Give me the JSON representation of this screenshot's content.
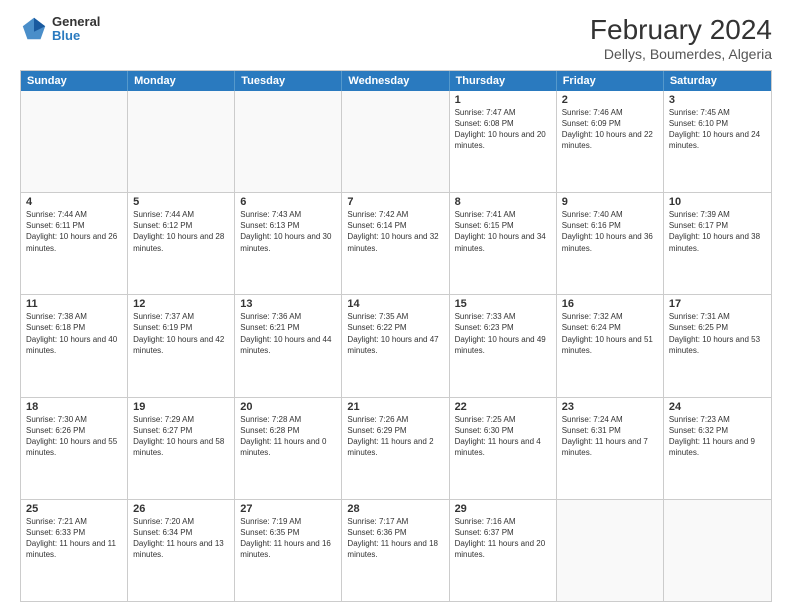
{
  "logo": {
    "general": "General",
    "blue": "Blue"
  },
  "title": "February 2024",
  "subtitle": "Dellys, Boumerdes, Algeria",
  "days": [
    "Sunday",
    "Monday",
    "Tuesday",
    "Wednesday",
    "Thursday",
    "Friday",
    "Saturday"
  ],
  "weeks": [
    [
      {
        "day": "",
        "text": ""
      },
      {
        "day": "",
        "text": ""
      },
      {
        "day": "",
        "text": ""
      },
      {
        "day": "",
        "text": ""
      },
      {
        "day": "1",
        "text": "Sunrise: 7:47 AM\nSunset: 6:08 PM\nDaylight: 10 hours and 20 minutes."
      },
      {
        "day": "2",
        "text": "Sunrise: 7:46 AM\nSunset: 6:09 PM\nDaylight: 10 hours and 22 minutes."
      },
      {
        "day": "3",
        "text": "Sunrise: 7:45 AM\nSunset: 6:10 PM\nDaylight: 10 hours and 24 minutes."
      }
    ],
    [
      {
        "day": "4",
        "text": "Sunrise: 7:44 AM\nSunset: 6:11 PM\nDaylight: 10 hours and 26 minutes."
      },
      {
        "day": "5",
        "text": "Sunrise: 7:44 AM\nSunset: 6:12 PM\nDaylight: 10 hours and 28 minutes."
      },
      {
        "day": "6",
        "text": "Sunrise: 7:43 AM\nSunset: 6:13 PM\nDaylight: 10 hours and 30 minutes."
      },
      {
        "day": "7",
        "text": "Sunrise: 7:42 AM\nSunset: 6:14 PM\nDaylight: 10 hours and 32 minutes."
      },
      {
        "day": "8",
        "text": "Sunrise: 7:41 AM\nSunset: 6:15 PM\nDaylight: 10 hours and 34 minutes."
      },
      {
        "day": "9",
        "text": "Sunrise: 7:40 AM\nSunset: 6:16 PM\nDaylight: 10 hours and 36 minutes."
      },
      {
        "day": "10",
        "text": "Sunrise: 7:39 AM\nSunset: 6:17 PM\nDaylight: 10 hours and 38 minutes."
      }
    ],
    [
      {
        "day": "11",
        "text": "Sunrise: 7:38 AM\nSunset: 6:18 PM\nDaylight: 10 hours and 40 minutes."
      },
      {
        "day": "12",
        "text": "Sunrise: 7:37 AM\nSunset: 6:19 PM\nDaylight: 10 hours and 42 minutes."
      },
      {
        "day": "13",
        "text": "Sunrise: 7:36 AM\nSunset: 6:21 PM\nDaylight: 10 hours and 44 minutes."
      },
      {
        "day": "14",
        "text": "Sunrise: 7:35 AM\nSunset: 6:22 PM\nDaylight: 10 hours and 47 minutes."
      },
      {
        "day": "15",
        "text": "Sunrise: 7:33 AM\nSunset: 6:23 PM\nDaylight: 10 hours and 49 minutes."
      },
      {
        "day": "16",
        "text": "Sunrise: 7:32 AM\nSunset: 6:24 PM\nDaylight: 10 hours and 51 minutes."
      },
      {
        "day": "17",
        "text": "Sunrise: 7:31 AM\nSunset: 6:25 PM\nDaylight: 10 hours and 53 minutes."
      }
    ],
    [
      {
        "day": "18",
        "text": "Sunrise: 7:30 AM\nSunset: 6:26 PM\nDaylight: 10 hours and 55 minutes."
      },
      {
        "day": "19",
        "text": "Sunrise: 7:29 AM\nSunset: 6:27 PM\nDaylight: 10 hours and 58 minutes."
      },
      {
        "day": "20",
        "text": "Sunrise: 7:28 AM\nSunset: 6:28 PM\nDaylight: 11 hours and 0 minutes."
      },
      {
        "day": "21",
        "text": "Sunrise: 7:26 AM\nSunset: 6:29 PM\nDaylight: 11 hours and 2 minutes."
      },
      {
        "day": "22",
        "text": "Sunrise: 7:25 AM\nSunset: 6:30 PM\nDaylight: 11 hours and 4 minutes."
      },
      {
        "day": "23",
        "text": "Sunrise: 7:24 AM\nSunset: 6:31 PM\nDaylight: 11 hours and 7 minutes."
      },
      {
        "day": "24",
        "text": "Sunrise: 7:23 AM\nSunset: 6:32 PM\nDaylight: 11 hours and 9 minutes."
      }
    ],
    [
      {
        "day": "25",
        "text": "Sunrise: 7:21 AM\nSunset: 6:33 PM\nDaylight: 11 hours and 11 minutes."
      },
      {
        "day": "26",
        "text": "Sunrise: 7:20 AM\nSunset: 6:34 PM\nDaylight: 11 hours and 13 minutes."
      },
      {
        "day": "27",
        "text": "Sunrise: 7:19 AM\nSunset: 6:35 PM\nDaylight: 11 hours and 16 minutes."
      },
      {
        "day": "28",
        "text": "Sunrise: 7:17 AM\nSunset: 6:36 PM\nDaylight: 11 hours and 18 minutes."
      },
      {
        "day": "29",
        "text": "Sunrise: 7:16 AM\nSunset: 6:37 PM\nDaylight: 11 hours and 20 minutes."
      },
      {
        "day": "",
        "text": ""
      },
      {
        "day": "",
        "text": ""
      }
    ]
  ]
}
